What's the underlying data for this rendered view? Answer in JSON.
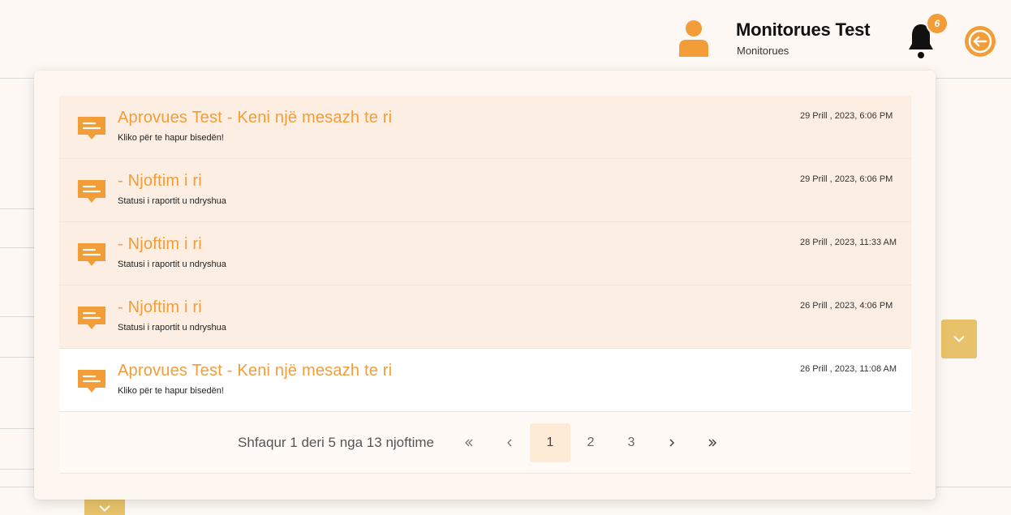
{
  "header": {
    "user_name": "Monitorues Test",
    "user_role": "Monitorues",
    "notification_count": "6"
  },
  "notifications": {
    "items": [
      {
        "title": "Aprovues Test - Keni një mesazh te ri",
        "body": "Kliko për te hapur bisedën!",
        "time": "29 Prill , 2023, 6:06 PM",
        "state": "unread"
      },
      {
        "title": "- Njoftim i ri",
        "body": "Statusi i raportit u ndryshua",
        "time": "29 Prill , 2023, 6:06 PM",
        "state": "unread"
      },
      {
        "title": "- Njoftim i ri",
        "body": "Statusi i raportit u ndryshua",
        "time": "28 Prill , 2023, 11:33 AM",
        "state": "unread"
      },
      {
        "title": "- Njoftim i ri",
        "body": "Statusi i raportit u ndryshua",
        "time": "26 Prill , 2023, 4:06 PM",
        "state": "unread"
      },
      {
        "title": "Aprovues Test - Keni një mesazh te ri",
        "body": "Kliko për te hapur bisedën!",
        "time": "26 Prill , 2023, 11:08 AM",
        "state": "read"
      }
    ],
    "pagination": {
      "info": "Shfaqur 1 deri 5 nga 13 njoftime",
      "first": "<<",
      "prev": "<",
      "pages": [
        "1",
        "2",
        "3"
      ],
      "current_page": "1",
      "next": ">",
      "last": ">>"
    }
  },
  "icons": {
    "user": "user-icon",
    "bell": "bell-icon",
    "logout": "logout-icon",
    "message": "message-icon",
    "chevron": "chevron-down-icon"
  },
  "colors": {
    "accent": "#f29d38",
    "unread_bg": "#fdeee3",
    "read_bg": "#ffffff",
    "select_bg": "#e8c26a"
  }
}
